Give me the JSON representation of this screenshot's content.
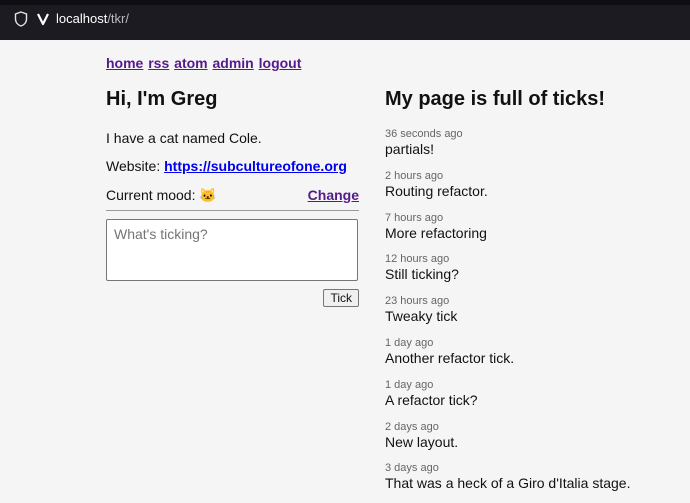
{
  "browser": {
    "url_host": "localhost",
    "url_path": "/tkr/"
  },
  "nav": {
    "items": [
      {
        "label": "home"
      },
      {
        "label": "rss"
      },
      {
        "label": "atom"
      },
      {
        "label": "admin"
      },
      {
        "label": "logout"
      }
    ]
  },
  "profile": {
    "greeting": "Hi, I'm Greg",
    "bio": "I have a cat named Cole.",
    "website_label": "Website:",
    "website_url": "https://subcultureofone.org",
    "mood_label": "Current mood:",
    "mood_emoji": "🐱",
    "change_label": "Change"
  },
  "composer": {
    "placeholder": "What's ticking?",
    "button_label": "Tick"
  },
  "feed": {
    "title": "My page is full of ticks!",
    "ticks": [
      {
        "time": "36 seconds ago",
        "text": "partials!"
      },
      {
        "time": "2 hours ago",
        "text": "Routing refactor."
      },
      {
        "time": "7 hours ago",
        "text": "More refactoring"
      },
      {
        "time": "12 hours ago",
        "text": "Still ticking?"
      },
      {
        "time": "23 hours ago",
        "text": "Tweaky tick"
      },
      {
        "time": "1 day ago",
        "text": "Another refactor tick."
      },
      {
        "time": "1 day ago",
        "text": "A refactor tick?"
      },
      {
        "time": "2 days ago",
        "text": "New layout."
      },
      {
        "time": "3 days ago",
        "text": "That was a heck of a Giro d'Italia stage."
      }
    ]
  }
}
